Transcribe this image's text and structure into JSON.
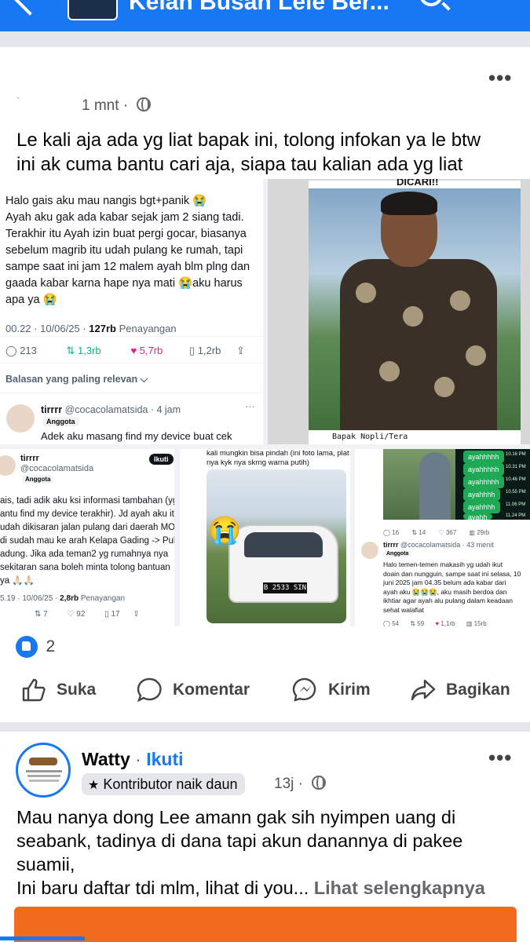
{
  "header": {
    "group_title": "Kelah Busah Lele Ber...",
    "accent": "#1877f2"
  },
  "post1": {
    "time": "1 mnt",
    "text_line1": "Le kali aja ada yg liat bapak ini, tolong infokan ya le btw",
    "text_line2": "ini ak cuma bantu cari aja, siapa tau kalian ada yg liat",
    "reaction_count": "2",
    "actions": {
      "like": "Suka",
      "comment": "Komentar",
      "send": "Kirim",
      "share": "Bagikan"
    }
  },
  "tweet1": {
    "lines": [
      "Halo gais aku mau nangis bgt+panik 😭",
      "Ayah aku gak ada kabar sejak jam 2 siang tadi.",
      "Terakhir itu Ayah izin buat pergi gocar, biasanya",
      "sebelum magrib itu udah pulang ke rumah, tapi",
      "sampe saat ini jam 12 malem ayah blm plng dan",
      "gaada kabar karna hape nya mati 😭aku harus",
      "apa ya 😭"
    ],
    "timestamp": "00.22 · 10/06/25 ·",
    "views": "127rb",
    "views_label": "Penayangan",
    "replies": "213",
    "retweets": "1,3rb",
    "likes": "5,7rb",
    "bookmarks": "1,2rb",
    "relevan": "Balasan yang paling relevan",
    "reply_user": "tirrrr",
    "reply_handle": "@cocacolamatsida · 4 jam",
    "reply_badge": "Anggota",
    "reply_text": "Adek aku masang find my device buat cek"
  },
  "photo1": {
    "caption": "Bapak Nopli/Tera",
    "top_text": "DICARI!!"
  },
  "tweet2": {
    "user": "tirrrr",
    "handle": "@cocacolamatsida",
    "badge": "Anggota",
    "follow": "Ikuti",
    "lines": [
      "ais, tadi adik aku ksi informasi tambahan (yg",
      "antu find my device terakhir). Jd ayah aku itu",
      "udah dikisaran jalan pulang dari daerah MOI,",
      "di sudah mau ke arah Kelapa Gading -> Pulo",
      "adung. Jika ada teman2 yg rumahnya nya",
      "sekitaran sana boleh minta tolong bantuan",
      "ya 🙏🏻🙏🏻"
    ],
    "timestamp": "5.19 · 10/06/25 ·",
    "views": "2,8rb",
    "views_label": "Penayangan",
    "retweets": "7",
    "likes": "92",
    "bookmarks": "17"
  },
  "tweet3": {
    "lines": [
      "kali mungkin bisa pindah  (ini foto lama, plat",
      "nya kyk nya skrng warna putih)"
    ],
    "plate": "B 2533 SIN"
  },
  "tweet4": {
    "chat": [
      "ayahhhhh",
      "ayahhhhh",
      "ayahhhhh",
      "ayahhhh",
      "ayahhhh",
      "ayahh"
    ],
    "chat_times": [
      "10.16 PM",
      "10.31 PM",
      "10.46 PM",
      "10.55 PM",
      "11.06 PM",
      "11.24 PM"
    ],
    "stats": [
      "16",
      "14",
      "367",
      "29rb"
    ],
    "user": "tirrrr",
    "handle": "@cocacolamatsida · 43 menit",
    "badge": "Anggota",
    "lines": [
      "Halo temen-temen makasih yg udah ikut",
      "doain dan nungguin, sampe saat ini selasa, 10",
      "juni 2025 jam 04.35 belum ada kabar dari",
      "ayah aku 😭😭😭, aku masih berdoa dan",
      "ikhtiar agar ayah alu pulang dalam keadaan",
      "sehat walafiat"
    ],
    "stats2": [
      "54",
      "59",
      "1,1rb",
      "15rb"
    ]
  },
  "post2": {
    "author": "Watty",
    "follow": "Ikuti",
    "badge": "Kontributor naik daun",
    "time": "13j",
    "text_lines": [
      "Mau nanya dong Lee amann gak sih nyimpen uang di",
      "seabank, tadinya di dana tapi akun danannya di pakee",
      "suamii,"
    ],
    "text_last": "Ini baru daftar tdi mlm, lihat di you...",
    "see_more": "Lihat selengkapnya"
  }
}
